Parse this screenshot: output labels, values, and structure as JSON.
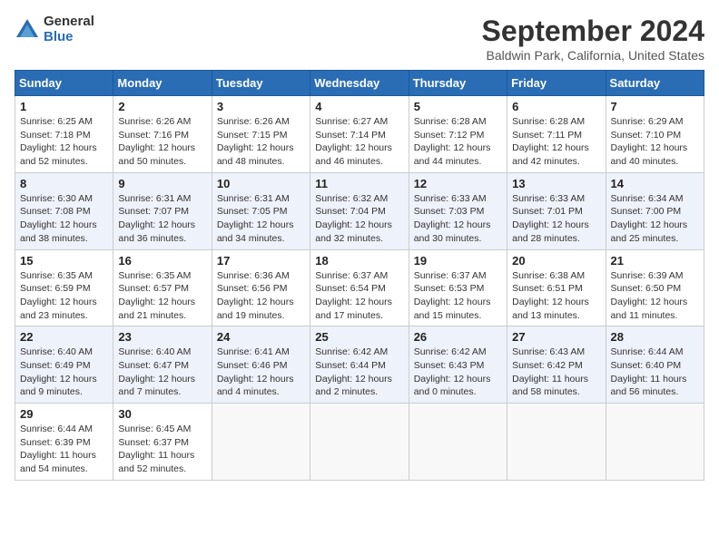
{
  "logo": {
    "general": "General",
    "blue": "Blue"
  },
  "title": "September 2024",
  "location": "Baldwin Park, California, United States",
  "days_header": [
    "Sunday",
    "Monday",
    "Tuesday",
    "Wednesday",
    "Thursday",
    "Friday",
    "Saturday"
  ],
  "weeks": [
    [
      {
        "day": "1",
        "rise": "6:25 AM",
        "set": "7:18 PM",
        "daylight": "12 hours and 52 minutes."
      },
      {
        "day": "2",
        "rise": "6:26 AM",
        "set": "7:16 PM",
        "daylight": "12 hours and 50 minutes."
      },
      {
        "day": "3",
        "rise": "6:26 AM",
        "set": "7:15 PM",
        "daylight": "12 hours and 48 minutes."
      },
      {
        "day": "4",
        "rise": "6:27 AM",
        "set": "7:14 PM",
        "daylight": "12 hours and 46 minutes."
      },
      {
        "day": "5",
        "rise": "6:28 AM",
        "set": "7:12 PM",
        "daylight": "12 hours and 44 minutes."
      },
      {
        "day": "6",
        "rise": "6:28 AM",
        "set": "7:11 PM",
        "daylight": "12 hours and 42 minutes."
      },
      {
        "day": "7",
        "rise": "6:29 AM",
        "set": "7:10 PM",
        "daylight": "12 hours and 40 minutes."
      }
    ],
    [
      {
        "day": "8",
        "rise": "6:30 AM",
        "set": "7:08 PM",
        "daylight": "12 hours and 38 minutes."
      },
      {
        "day": "9",
        "rise": "6:31 AM",
        "set": "7:07 PM",
        "daylight": "12 hours and 36 minutes."
      },
      {
        "day": "10",
        "rise": "6:31 AM",
        "set": "7:05 PM",
        "daylight": "12 hours and 34 minutes."
      },
      {
        "day": "11",
        "rise": "6:32 AM",
        "set": "7:04 PM",
        "daylight": "12 hours and 32 minutes."
      },
      {
        "day": "12",
        "rise": "6:33 AM",
        "set": "7:03 PM",
        "daylight": "12 hours and 30 minutes."
      },
      {
        "day": "13",
        "rise": "6:33 AM",
        "set": "7:01 PM",
        "daylight": "12 hours and 28 minutes."
      },
      {
        "day": "14",
        "rise": "6:34 AM",
        "set": "7:00 PM",
        "daylight": "12 hours and 25 minutes."
      }
    ],
    [
      {
        "day": "15",
        "rise": "6:35 AM",
        "set": "6:59 PM",
        "daylight": "12 hours and 23 minutes."
      },
      {
        "day": "16",
        "rise": "6:35 AM",
        "set": "6:57 PM",
        "daylight": "12 hours and 21 minutes."
      },
      {
        "day": "17",
        "rise": "6:36 AM",
        "set": "6:56 PM",
        "daylight": "12 hours and 19 minutes."
      },
      {
        "day": "18",
        "rise": "6:37 AM",
        "set": "6:54 PM",
        "daylight": "12 hours and 17 minutes."
      },
      {
        "day": "19",
        "rise": "6:37 AM",
        "set": "6:53 PM",
        "daylight": "12 hours and 15 minutes."
      },
      {
        "day": "20",
        "rise": "6:38 AM",
        "set": "6:51 PM",
        "daylight": "12 hours and 13 minutes."
      },
      {
        "day": "21",
        "rise": "6:39 AM",
        "set": "6:50 PM",
        "daylight": "12 hours and 11 minutes."
      }
    ],
    [
      {
        "day": "22",
        "rise": "6:40 AM",
        "set": "6:49 PM",
        "daylight": "12 hours and 9 minutes."
      },
      {
        "day": "23",
        "rise": "6:40 AM",
        "set": "6:47 PM",
        "daylight": "12 hours and 7 minutes."
      },
      {
        "day": "24",
        "rise": "6:41 AM",
        "set": "6:46 PM",
        "daylight": "12 hours and 4 minutes."
      },
      {
        "day": "25",
        "rise": "6:42 AM",
        "set": "6:44 PM",
        "daylight": "12 hours and 2 minutes."
      },
      {
        "day": "26",
        "rise": "6:42 AM",
        "set": "6:43 PM",
        "daylight": "12 hours and 0 minutes."
      },
      {
        "day": "27",
        "rise": "6:43 AM",
        "set": "6:42 PM",
        "daylight": "11 hours and 58 minutes."
      },
      {
        "day": "28",
        "rise": "6:44 AM",
        "set": "6:40 PM",
        "daylight": "11 hours and 56 minutes."
      }
    ],
    [
      {
        "day": "29",
        "rise": "6:44 AM",
        "set": "6:39 PM",
        "daylight": "11 hours and 54 minutes."
      },
      {
        "day": "30",
        "rise": "6:45 AM",
        "set": "6:37 PM",
        "daylight": "11 hours and 52 minutes."
      },
      null,
      null,
      null,
      null,
      null
    ]
  ]
}
